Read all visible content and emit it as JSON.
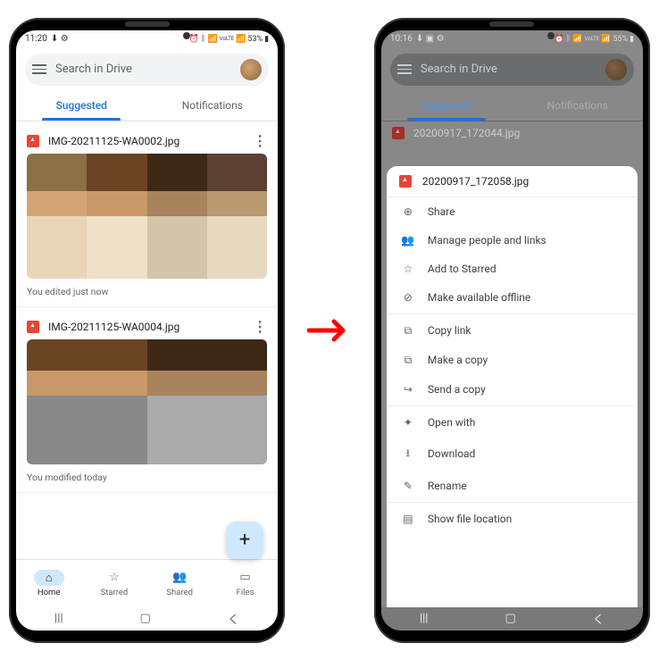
{
  "left": {
    "status_time": "11:20",
    "status_icons_left": "⬇ ⚙",
    "status_battery": "53%",
    "search_placeholder": "Search in Drive",
    "tabs": {
      "suggested": "Suggested",
      "notifications": "Notifications"
    },
    "files": [
      {
        "name": "IMG-20211125-WA0002.jpg",
        "meta": "You edited just now"
      },
      {
        "name": "IMG-20211125-WA0004.jpg",
        "meta": "You modified today"
      }
    ],
    "fab": "+",
    "nav": {
      "home": "Home",
      "starred": "Starred",
      "shared": "Shared",
      "files": "Files"
    }
  },
  "right": {
    "status_time": "10:16",
    "status_icons_left": "⬇ ▣ ⚙",
    "status_battery": "55%",
    "search_placeholder": "Search in Drive",
    "tabs": {
      "suggested": "Suggested",
      "notifications": "Notifications"
    },
    "background_file": "20200917_172044.jpg",
    "sheet_file": "20200917_172058.jpg",
    "menu": [
      {
        "icon": "person-plus-icon",
        "glyph": "⊕",
        "label": "Share"
      },
      {
        "icon": "people-icon",
        "glyph": "👥",
        "label": "Manage people and links"
      },
      {
        "icon": "star-icon",
        "glyph": "☆",
        "label": "Add to Starred"
      },
      {
        "icon": "offline-icon",
        "glyph": "⊘",
        "label": "Make available offline"
      },
      {
        "sep": true
      },
      {
        "icon": "link-icon",
        "glyph": "⧉",
        "label": "Copy link"
      },
      {
        "icon": "copy-icon",
        "glyph": "⧉",
        "label": "Make a copy"
      },
      {
        "icon": "send-icon",
        "glyph": "↪",
        "label": "Send a copy"
      },
      {
        "sep": true
      },
      {
        "icon": "open-with-icon",
        "glyph": "✦",
        "label": "Open with"
      },
      {
        "icon": "download-icon",
        "glyph": "⭳",
        "label": "Download"
      },
      {
        "icon": "rename-icon",
        "glyph": "✎",
        "label": "Rename"
      },
      {
        "sep": true
      },
      {
        "icon": "location-icon",
        "glyph": "▤",
        "label": "Show file location"
      }
    ]
  }
}
